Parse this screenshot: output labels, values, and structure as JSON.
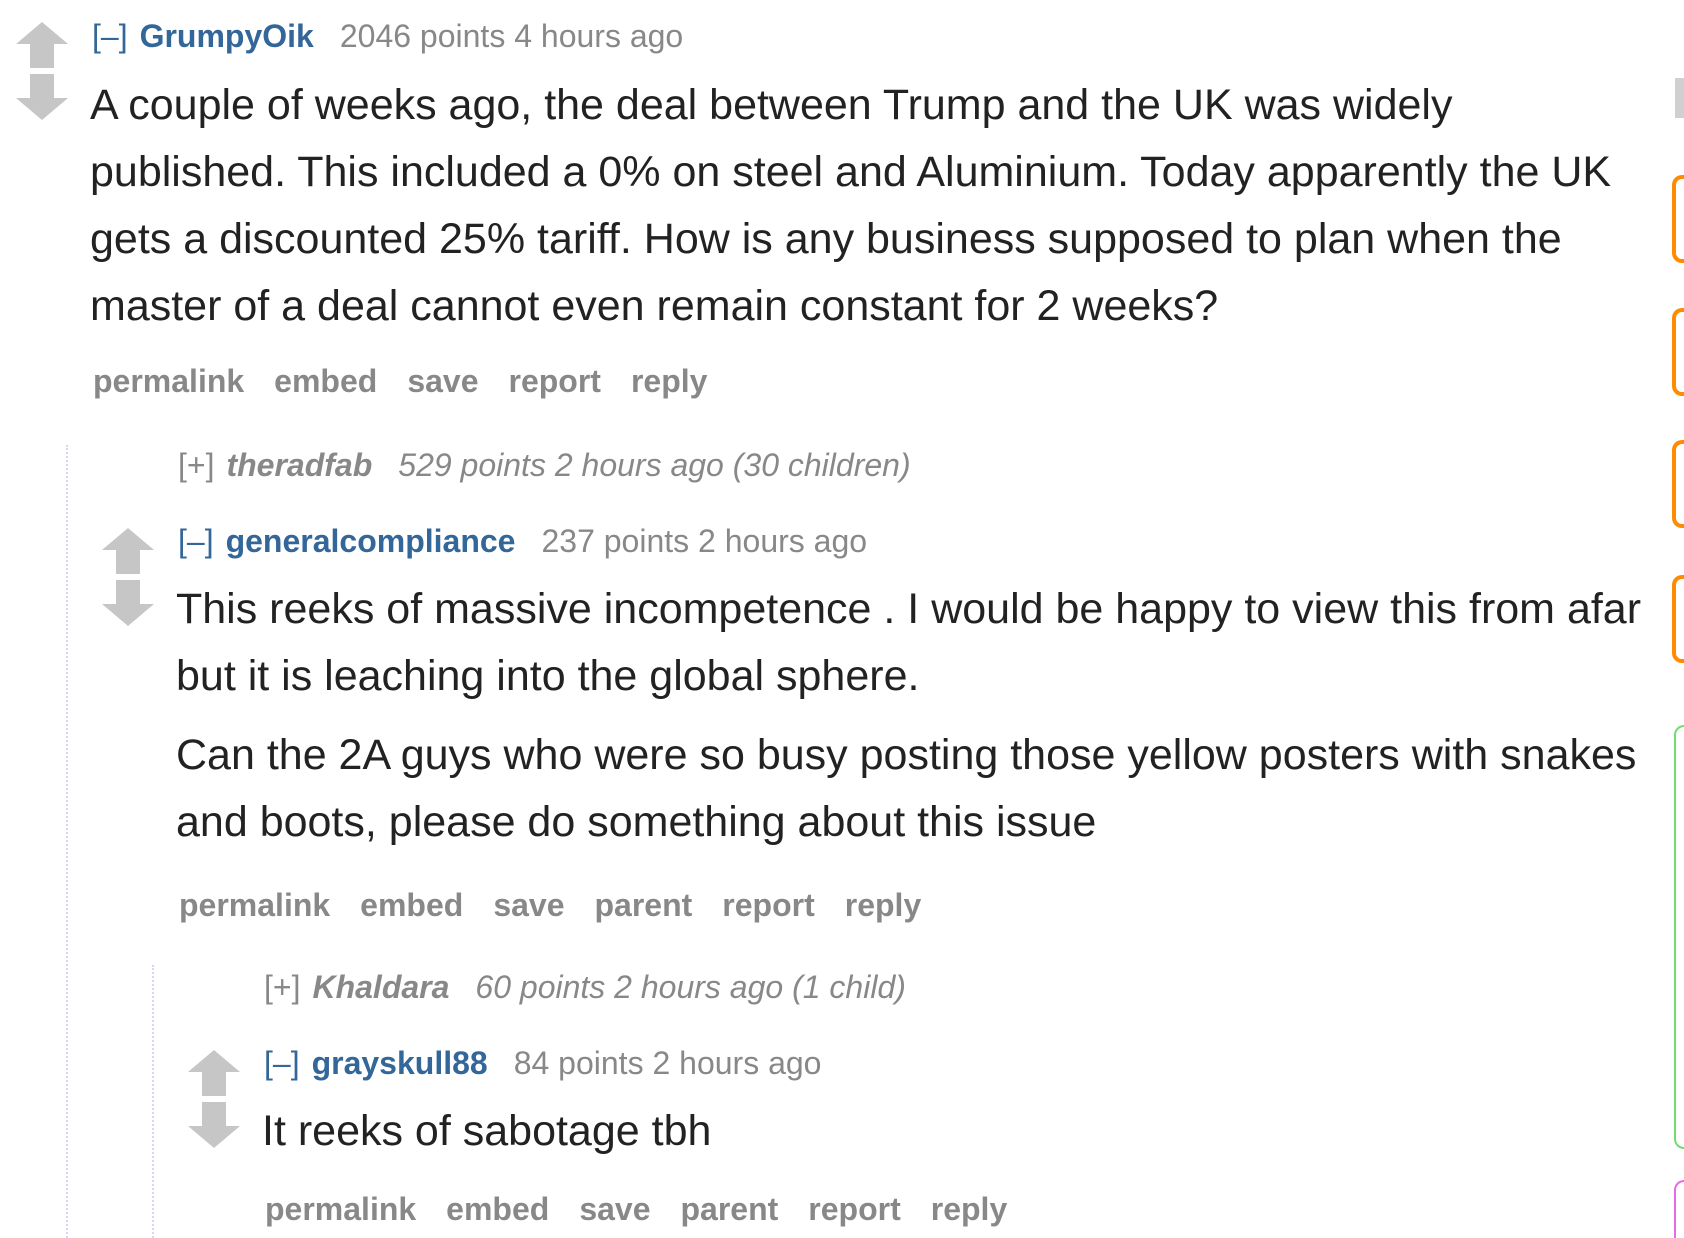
{
  "comments": {
    "c1": {
      "toggle": "[–]",
      "author": "GrumpyOik",
      "meta": "2046 points 4 hours ago",
      "body": [
        "A couple of weeks ago, the deal between Trump and the UK was widely published. This included a 0% on steel and Aluminium. Today apparently the UK gets a discounted 25% tariff. How is any business supposed to plan when the master of a deal cannot even remain constant for 2 weeks?"
      ],
      "buttons": [
        "permalink",
        "embed",
        "save",
        "report",
        "reply"
      ]
    },
    "c2": {
      "toggle": "[+]",
      "author": "theradfab",
      "meta": "529 points 2 hours ago (30 children)"
    },
    "c3": {
      "toggle": "[–]",
      "author": "generalcompliance",
      "meta": "237 points 2 hours ago",
      "body": [
        "This reeks of massive incompetence . I would be happy to view this from afar but it is leaching into the global sphere.",
        "Can the 2A guys who were so busy posting those yellow posters with snakes and boots, please do something about this issue"
      ],
      "buttons": [
        "permalink",
        "embed",
        "save",
        "parent",
        "report",
        "reply"
      ]
    },
    "c4": {
      "toggle": "[+]",
      "author": "Khaldara",
      "meta": "60 points 2 hours ago (1 child)"
    },
    "c5": {
      "toggle": "[–]",
      "author": "grayskull88",
      "meta": "84 points 2 hours ago",
      "body": [
        "It reeks of sabotage tbh"
      ],
      "buttons": [
        "permalink",
        "embed",
        "save",
        "parent",
        "report",
        "reply"
      ]
    }
  },
  "icons": {
    "upvote": "upvote-arrow-icon",
    "downvote": "downvote-arrow-icon"
  },
  "colors": {
    "author_link": "#336699",
    "meta_text": "#888888",
    "body_text": "#222222",
    "vote_arrow": "#c6c6c6",
    "thread_line": "#d8d8f0",
    "sidebar_orange": "#ff8b00",
    "sidebar_green": "#6fdc6f",
    "sidebar_pink": "#e66be6"
  }
}
